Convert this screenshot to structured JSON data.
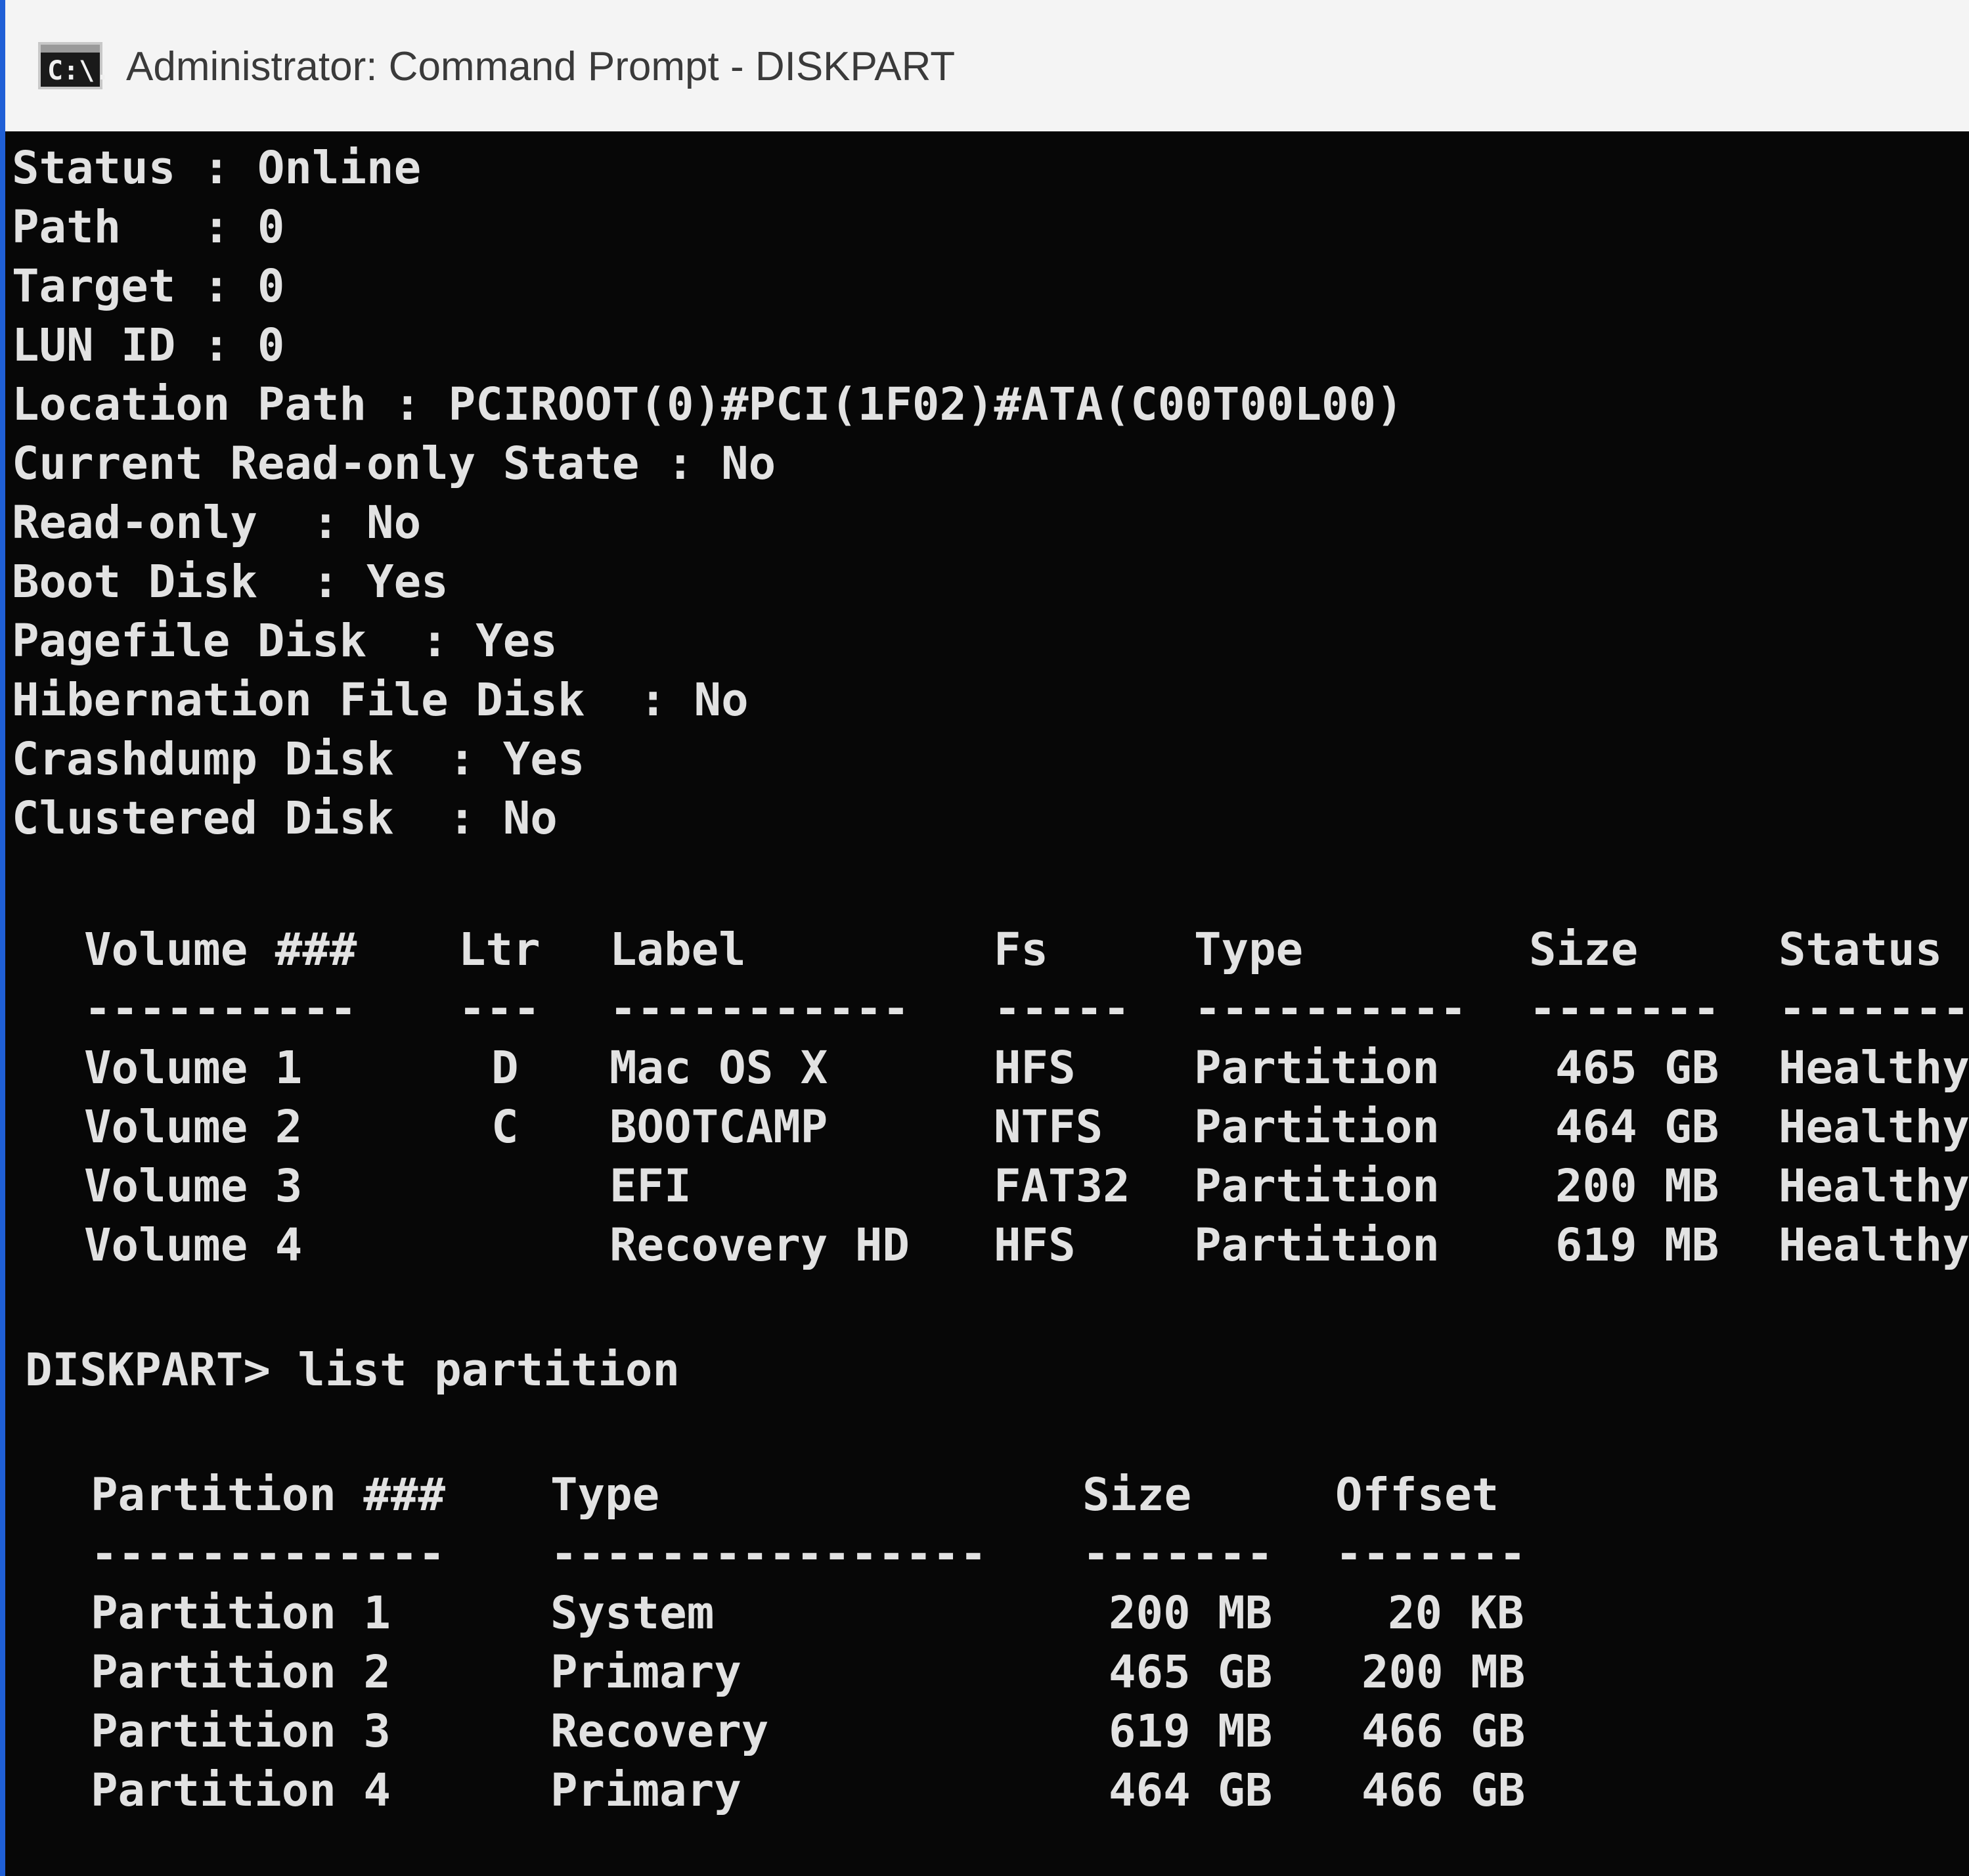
{
  "window": {
    "title": "Administrator: Command Prompt - DISKPART",
    "icon": "cmd-icon",
    "icon_text": "C:\\.",
    "accent_color": "#1f5fd6"
  },
  "console": {
    "info_lines": [
      "Status : Online",
      "Path   : 0",
      "Target : 0",
      "LUN ID : 0",
      "Location Path : PCIROOT(0)#PCI(1F02)#ATA(C00T00L00)",
      "Current Read-only State : No",
      "Read-only  : No",
      "Boot Disk  : Yes",
      "Pagefile Disk  : Yes",
      "Hibernation File Disk  : No",
      "Crashdump Disk  : Yes",
      "Clustered Disk  : No"
    ],
    "volume_table": {
      "headers": [
        "Volume ###",
        "Ltr",
        "Label",
        "Fs",
        "Type",
        "Size",
        "Status"
      ],
      "separators": [
        "----------",
        "---",
        "-----------",
        "-----",
        "----------",
        "-------",
        "---------"
      ],
      "rows": [
        [
          "Volume 1",
          "D",
          "Mac OS X",
          "HFS",
          "Partition",
          "465 GB",
          "Healthy"
        ],
        [
          "Volume 2",
          "C",
          "BOOTCAMP",
          "NTFS",
          "Partition",
          "464 GB",
          "Healthy"
        ],
        [
          "Volume 3",
          "",
          "EFI",
          "FAT32",
          "Partition",
          "200 MB",
          "Healthy"
        ],
        [
          "Volume 4",
          "",
          "Recovery HD",
          "HFS",
          "Partition",
          "619 MB",
          "Healthy"
        ]
      ]
    },
    "command": "DISKPART> list partition",
    "partition_table": {
      "headers": [
        "Partition ###",
        "Type",
        "Size",
        "Offset"
      ],
      "separators": [
        "-------------",
        "----------------",
        "-------",
        "-------"
      ],
      "rows": [
        [
          "Partition 1",
          "System",
          "200 MB",
          "20 KB"
        ],
        [
          "Partition 2",
          "Primary",
          "465 GB",
          "200 MB"
        ],
        [
          "Partition 3",
          "Recovery",
          "619 MB",
          "466 GB"
        ],
        [
          "Partition 4",
          "Primary",
          "464 GB",
          "466 GB"
        ]
      ]
    }
  }
}
